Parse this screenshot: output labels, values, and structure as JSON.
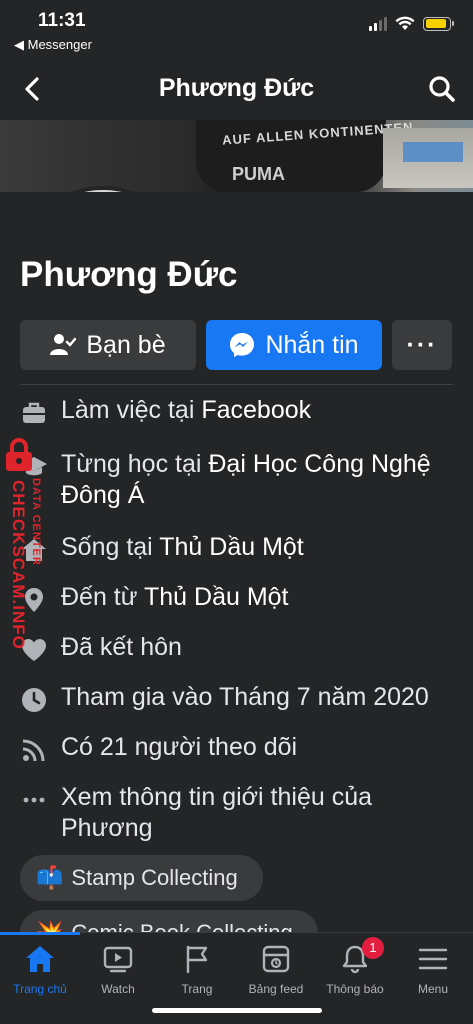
{
  "status_bar": {
    "time": "11:31",
    "back_app": "◀ Messenger"
  },
  "navbar": {
    "title": "Phương Đức"
  },
  "profile": {
    "name": "Phương Đức",
    "cover_shirt_text": "AUF ALLEN KONTINENTEN",
    "cover_brand": "PUMA",
    "buttons": {
      "friends": "Bạn bè",
      "message": "Nhắn tin",
      "more": "···"
    }
  },
  "info": {
    "work_prefix": "Làm việc tại ",
    "work_place": "Facebook",
    "study_prefix": "Từng học tại ",
    "study_place": "Đại Học Công Nghệ Đông Á",
    "lives_prefix": "Sống tại ",
    "lives_place": "Thủ Dầu Một",
    "from_prefix": "Đến từ ",
    "from_place": "Thủ Dầu Một",
    "relationship": "Đã kết hôn",
    "joined": "Tham gia vào Tháng 7 năm 2020",
    "followers": "Có 21 người theo dõi",
    "see_more": "Xem thông tin giới thiệu của Phương"
  },
  "hobbies": [
    {
      "emoji": "📫",
      "label": "Stamp Collecting"
    },
    {
      "emoji": "💥",
      "label": "Comic Book Collecting"
    }
  ],
  "watermark": {
    "line1": "DATA CENTER",
    "line2": "CHECKSCAM.INFO"
  },
  "tabbar": {
    "home": "Trang chủ",
    "watch": "Watch",
    "pages": "Trang",
    "feeds": "Bảng feed",
    "notifications": "Thông báo",
    "notifications_badge": "1",
    "menu": "Menu"
  },
  "colors": {
    "background": "#242526",
    "accent": "#1877f2",
    "button_secondary": "#3a3b3c",
    "badge": "#e41e3f",
    "watermark": "#e0242b"
  }
}
